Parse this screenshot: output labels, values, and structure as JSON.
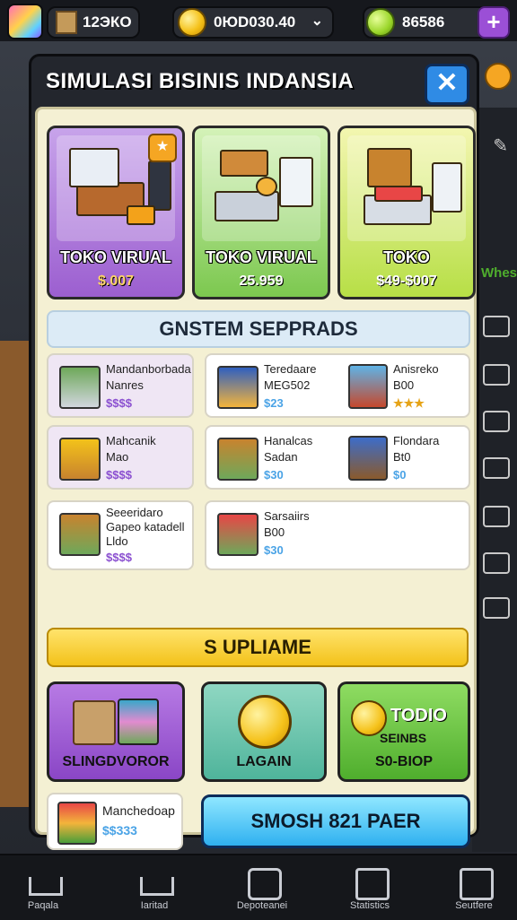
{
  "topbar": {
    "resource_1": "12ЭКО",
    "coins": "0ЮD030.40",
    "gems": "86586",
    "plus_label": "+"
  },
  "panel": {
    "title": "SIMULASI BISINIS INDANSIA",
    "close_label": "✕"
  },
  "cards": [
    {
      "name": "TOKO VIRUAL",
      "price": "$.007"
    },
    {
      "name": "TOKO VIRUAL",
      "price": "25.959"
    },
    {
      "name": "TOKO",
      "price": "$49-$007"
    }
  ],
  "section_title": "GNSTEM SEPPRADS",
  "items": [
    {
      "l1": "Mandanborbada",
      "l2": "Nanres",
      "l3": "$$$$"
    },
    {
      "l1": "Teredaare",
      "l2": "MEG502",
      "l3": "$23",
      "m1": "Anisreko",
      "m2": "B00",
      "m3": "★★★"
    },
    {
      "l1": "Mahcanik",
      "l2": "Mao",
      "l3": "$$$$"
    },
    {
      "l1": "Hanalcas",
      "l2": "Sadan",
      "l3": "$30",
      "m1": "Flondara",
      "m2": "Bt0",
      "m3": "$0"
    },
    {
      "l1": "Seeeridaro",
      "l2": "Gapeo katadell",
      "l3": "$$$$",
      "l0": "Lldo"
    },
    {
      "l1": "Sarsaiirs",
      "l2": "B00",
      "l3": "$30"
    }
  ],
  "upgrade_label": "S UPLIAME",
  "big_buttons": [
    {
      "label": "SLINGDVOROR"
    },
    {
      "label": "LAGAIN"
    },
    {
      "title": "TODIO",
      "subtitle": "SEINBS",
      "label": "S0-BIOP"
    }
  ],
  "bottom_card": {
    "l1": "Manchedoap",
    "l2": "$$333"
  },
  "cta_label": "SMOSH 821 PAER",
  "nav": [
    {
      "label": "Paqala"
    },
    {
      "label": "Iaritad"
    },
    {
      "label": "Depoteanei"
    },
    {
      "label": "Statistics"
    },
    {
      "label": "Seutfere"
    }
  ],
  "side_label": "Whes",
  "colors": {
    "accent": "#2f8be5",
    "panel": "#f4f0d3",
    "gold": "#f3c21a",
    "purple": "#9b4fd6",
    "green": "#4fae2d"
  }
}
